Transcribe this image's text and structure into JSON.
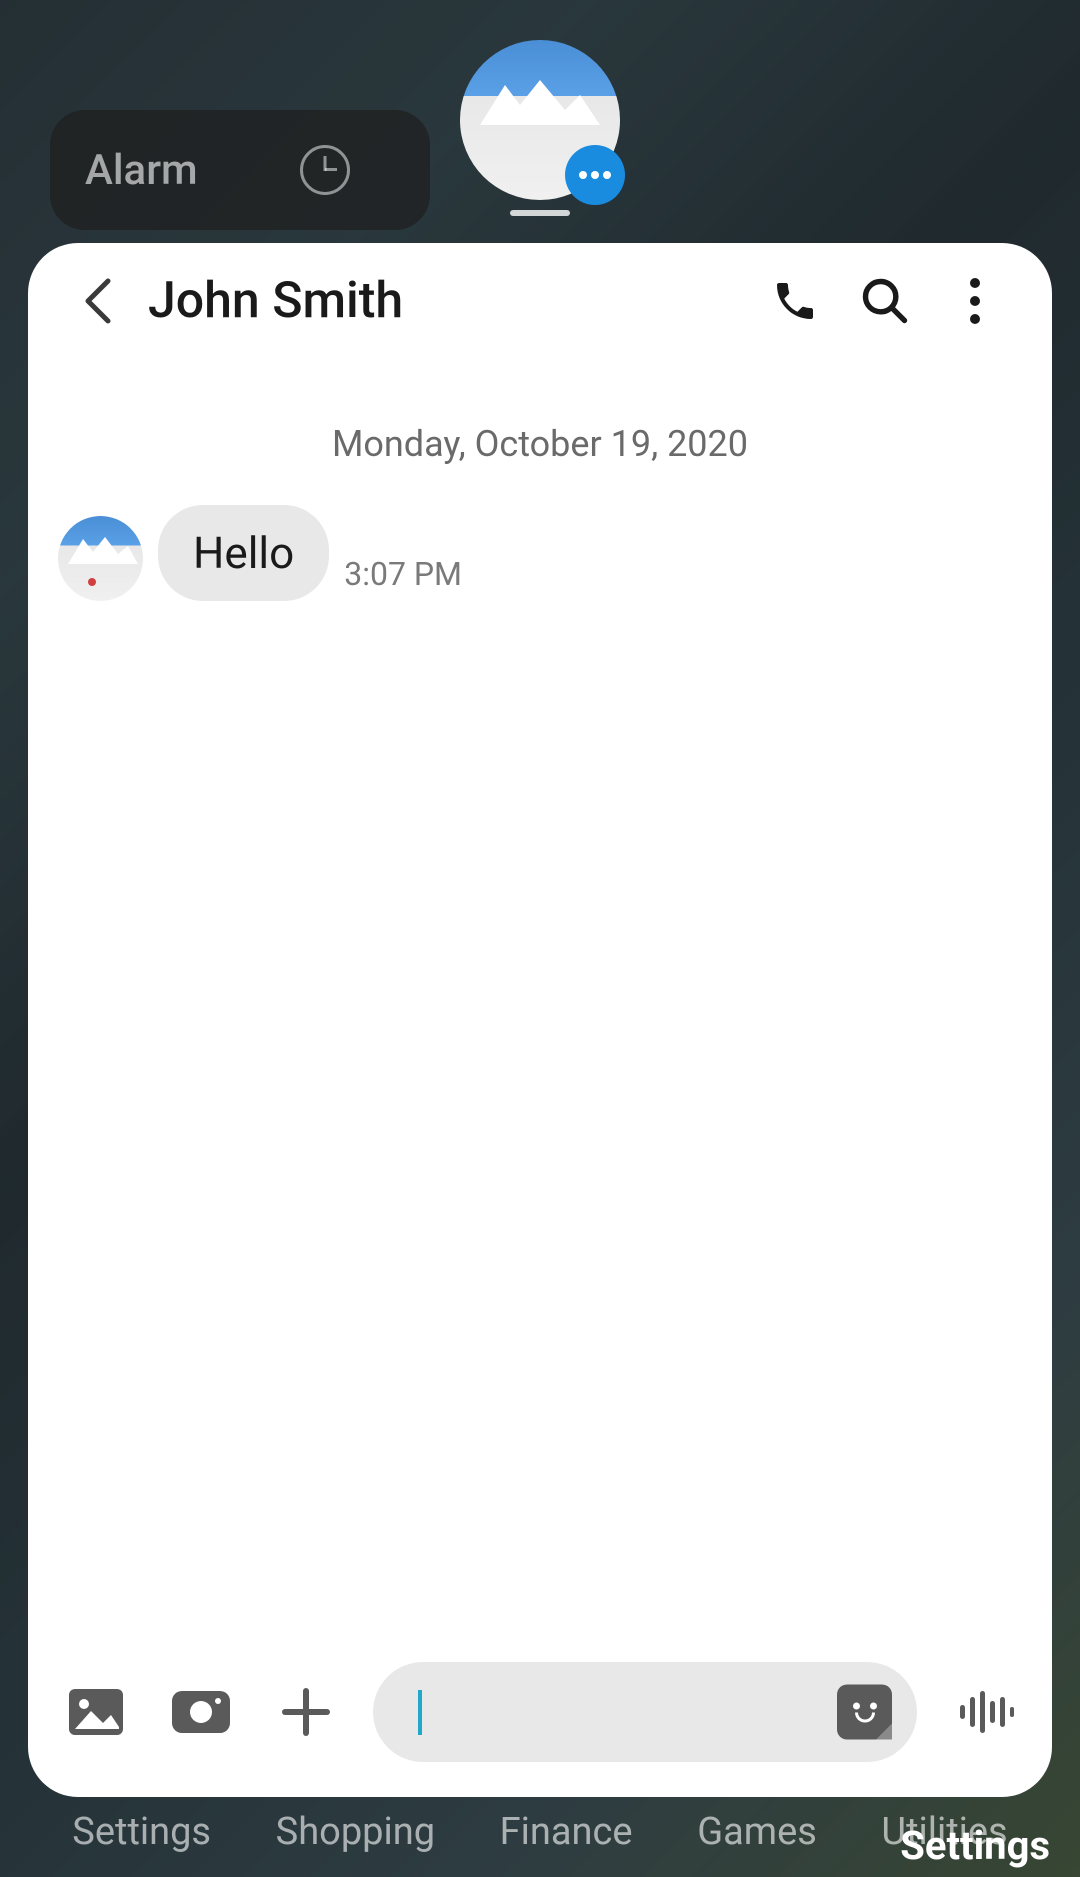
{
  "background": {
    "widget_label": "Alarm"
  },
  "chat": {
    "contact_name": "John Smith",
    "date_header": "Monday, October 19, 2020",
    "messages": [
      {
        "text": "Hello",
        "time": "3:07 PM"
      }
    ],
    "input_value": ""
  },
  "home_folders": [
    "Settings",
    "Shopping",
    "Finance",
    "Games",
    "Utilities"
  ],
  "overlay_label": "Settings"
}
